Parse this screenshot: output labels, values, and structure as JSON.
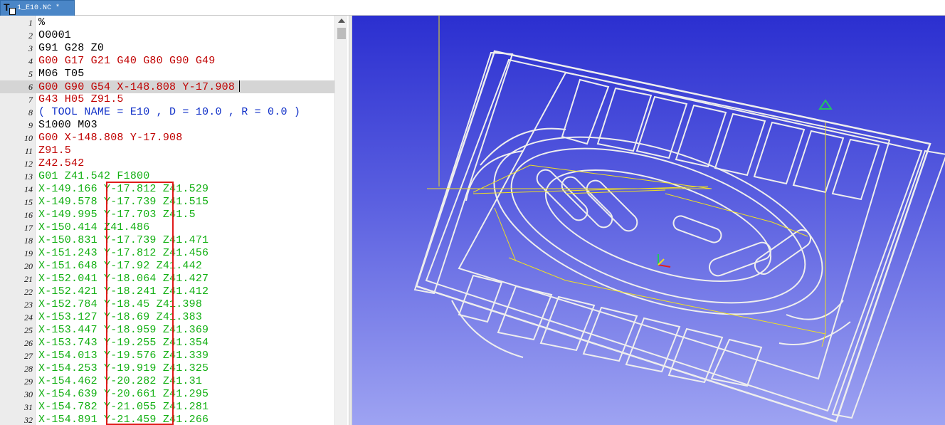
{
  "tab": {
    "title": "1_E10.NC *"
  },
  "editor": {
    "current_line": 6,
    "lines": [
      {
        "n": "1",
        "segments": [
          {
            "t": "%",
            "c": "black"
          }
        ]
      },
      {
        "n": "2",
        "segments": [
          {
            "t": "O0001",
            "c": "black"
          }
        ]
      },
      {
        "n": "3",
        "segments": [
          {
            "t": "G91 G28 Z0",
            "c": "black"
          }
        ]
      },
      {
        "n": "4",
        "segments": [
          {
            "t": "G00 G17 G21 G40 G80 G90 G49",
            "c": "red"
          }
        ]
      },
      {
        "n": "5",
        "segments": [
          {
            "t": "M06 T05",
            "c": "black"
          }
        ]
      },
      {
        "n": "6",
        "segments": [
          {
            "t": "G00 G90 G54 X-148.808 Y-17.908",
            "c": "red"
          }
        ]
      },
      {
        "n": "7",
        "segments": [
          {
            "t": "G43 H05 Z91.5",
            "c": "red"
          }
        ]
      },
      {
        "n": "8",
        "segments": [
          {
            "t": "( TOOL NAME = E10 , D = 10.0 , R = 0.0 )",
            "c": "blue"
          }
        ]
      },
      {
        "n": "9",
        "segments": [
          {
            "t": "S1000 M03",
            "c": "black"
          }
        ]
      },
      {
        "n": "10",
        "segments": [
          {
            "t": "G00 X-148.808 Y-17.908",
            "c": "red"
          }
        ]
      },
      {
        "n": "11",
        "segments": [
          {
            "t": "Z91.5",
            "c": "red"
          }
        ]
      },
      {
        "n": "12",
        "segments": [
          {
            "t": "Z42.542",
            "c": "red"
          }
        ]
      },
      {
        "n": "13",
        "segments": [
          {
            "t": "G01 Z41.542 F1800",
            "c": "green"
          }
        ]
      },
      {
        "n": "14",
        "segments": [
          {
            "t": "X-149.166 Y-17.812 Z41.529",
            "c": "green"
          }
        ]
      },
      {
        "n": "15",
        "segments": [
          {
            "t": "X-149.578 Y-17.739 Z41.515",
            "c": "green"
          }
        ]
      },
      {
        "n": "16",
        "segments": [
          {
            "t": "X-149.995 Y-17.703 Z41.5",
            "c": "green"
          }
        ]
      },
      {
        "n": "17",
        "segments": [
          {
            "t": "X-150.414 Z41.486",
            "c": "green"
          }
        ]
      },
      {
        "n": "18",
        "segments": [
          {
            "t": "X-150.831 Y-17.739 Z41.471",
            "c": "green"
          }
        ]
      },
      {
        "n": "19",
        "segments": [
          {
            "t": "X-151.243 Y-17.812 Z41.456",
            "c": "green"
          }
        ]
      },
      {
        "n": "20",
        "segments": [
          {
            "t": "X-151.648 Y-17.92 Z41.442",
            "c": "green"
          }
        ]
      },
      {
        "n": "21",
        "segments": [
          {
            "t": "X-152.041 Y-18.064 Z41.427",
            "c": "green"
          }
        ]
      },
      {
        "n": "22",
        "segments": [
          {
            "t": "X-152.421 Y-18.241 Z41.412",
            "c": "green"
          }
        ]
      },
      {
        "n": "23",
        "segments": [
          {
            "t": "X-152.784 Y-18.45 Z41.398",
            "c": "green"
          }
        ]
      },
      {
        "n": "24",
        "segments": [
          {
            "t": "X-153.127 Y-18.69 Z41.383",
            "c": "green"
          }
        ]
      },
      {
        "n": "25",
        "segments": [
          {
            "t": "X-153.447 Y-18.959 Z41.369",
            "c": "green"
          }
        ]
      },
      {
        "n": "26",
        "segments": [
          {
            "t": "X-153.743 Y-19.255 Z41.354",
            "c": "green"
          }
        ]
      },
      {
        "n": "27",
        "segments": [
          {
            "t": "X-154.013 Y-19.576 Z41.339",
            "c": "green"
          }
        ]
      },
      {
        "n": "28",
        "segments": [
          {
            "t": "X-154.253 Y-19.919 Z41.325",
            "c": "green"
          }
        ]
      },
      {
        "n": "29",
        "segments": [
          {
            "t": "X-154.462 Y-20.282 Z41.31",
            "c": "green"
          }
        ]
      },
      {
        "n": "30",
        "segments": [
          {
            "t": "X-154.639 Y-20.661 Z41.295",
            "c": "green"
          }
        ]
      },
      {
        "n": "31",
        "segments": [
          {
            "t": "X-154.782 Y-21.055 Z41.281",
            "c": "green"
          }
        ]
      },
      {
        "n": "32",
        "segments": [
          {
            "t": "X-154.891 Y-21.459 Z41.266",
            "c": "green"
          }
        ]
      }
    ]
  },
  "colors": {
    "black": "#000000",
    "red": "#c00000",
    "green": "#13b013",
    "blue": "#1030c8",
    "highlight_box": "#e01a1a",
    "toolpath": "#f0e020",
    "geometry": "#eeeeee",
    "tab_active": "#4a86c7"
  },
  "icons": [
    "text-file-icon",
    "scroll-up-arrow-icon",
    "z-axis-triangle-icon",
    "origin-axes-icon"
  ]
}
